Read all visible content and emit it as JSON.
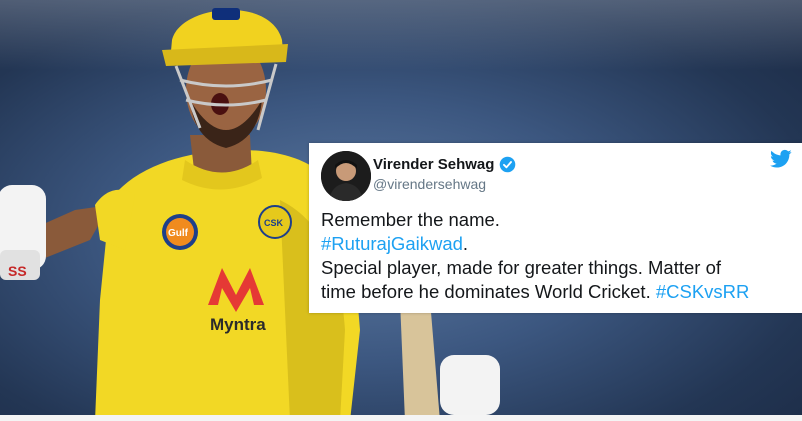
{
  "tweet": {
    "display_name": "Virender Sehwag",
    "handle": "@virendersehwag",
    "verified": true,
    "line1": "Remember the name.",
    "hashtag1": "#RuturajGaikwad",
    "hashtag1_suffix": ".",
    "line3": "Special player, made for greater things. Matter of",
    "line4_text": "time before he dominates World Cricket. ",
    "hashtag2": "#CSKvsRR"
  },
  "photo": {
    "helmet_logo_text": "CSK",
    "sponsor_logo": "Gulf",
    "jersey_sponsor": "Myntra",
    "glove_brand": "SS"
  },
  "colors": {
    "link": "#1da1f2",
    "verified": "#1da1f2",
    "jersey": "#f4de28",
    "background": "#2f4566"
  },
  "icons": [
    "twitter-bird-icon",
    "verified-badge-icon"
  ]
}
